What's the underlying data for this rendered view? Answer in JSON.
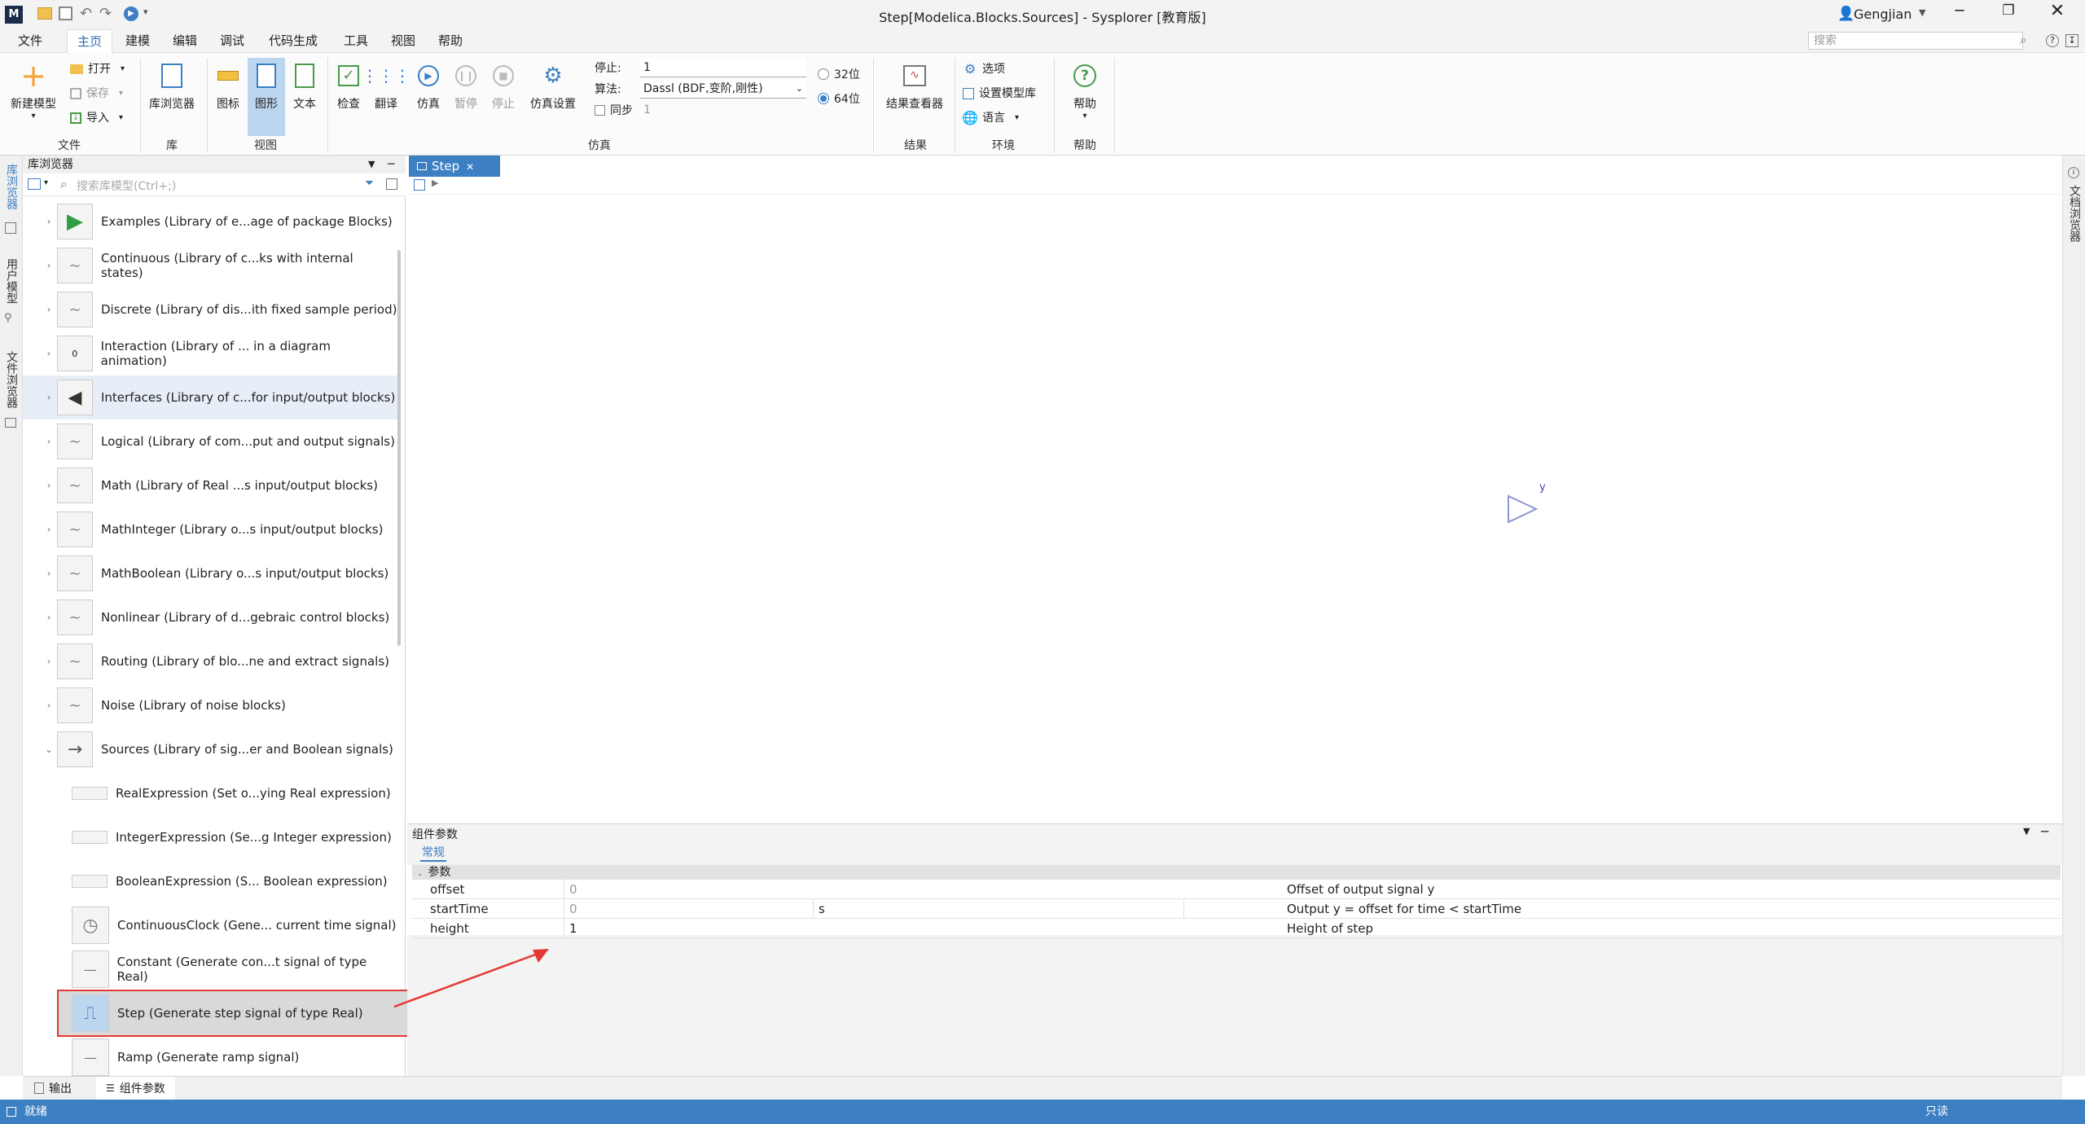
{
  "window": {
    "title": "Step[Modelica.Blocks.Sources] - Sysplorer [教育版]",
    "user": "Gengjian"
  },
  "menus": [
    "文件",
    "主页",
    "建模",
    "编辑",
    "调试",
    "代码生成",
    "工具",
    "视图",
    "帮助"
  ],
  "search_placeholder": "搜索",
  "ribbon": {
    "file_group": {
      "label": "文件",
      "new_model": "新建模型",
      "open": "打开",
      "save": "保存",
      "import": "导入"
    },
    "lib_group": {
      "label": "库",
      "lib_browser": "库浏览器"
    },
    "view_group": {
      "label": "视图",
      "icon": "图标",
      "diagram": "图形",
      "text": "文本"
    },
    "sim_group": {
      "label": "仿真",
      "check": "检查",
      "translate": "翻译",
      "simulate": "仿真",
      "pause": "暂停",
      "stop": "停止",
      "sim_settings": "仿真设置",
      "stop_label": "停止:",
      "stop_value": "1",
      "algo_label": "算法:",
      "algo_value": "Dassl (BDF,变阶,刚性)",
      "sync_label": "同步",
      "sync_value": "1",
      "bits32": "32位",
      "bits64": "64位"
    },
    "result_group": {
      "label": "结果",
      "viewer": "结果查看器"
    },
    "env_group": {
      "label": "环境",
      "options": "选项",
      "set_lib": "设置模型库",
      "language": "语言"
    },
    "help_group": {
      "label": "帮助",
      "help": "帮助"
    }
  },
  "left_tabs": [
    "库浏览器",
    "用户模型",
    "文件浏览器"
  ],
  "right_tabs": [
    "文档浏览器"
  ],
  "library": {
    "header": "库浏览器",
    "search_placeholder": "搜索库模型(Ctrl+;)",
    "items": [
      {
        "label": "Examples (Library of e...age of package Blocks)"
      },
      {
        "label": "Continuous (Library of c...ks with internal states)"
      },
      {
        "label": "Discrete (Library of dis...ith fixed sample period)"
      },
      {
        "label": "Interaction (Library of ... in a diagram animation)"
      },
      {
        "label": "Interfaces (Library of c...for input/output blocks)"
      },
      {
        "label": "Logical (Library of com...put and output signals)"
      },
      {
        "label": "Math (Library of Real ...s input/output blocks)"
      },
      {
        "label": "MathInteger (Library o...s input/output blocks)"
      },
      {
        "label": "MathBoolean (Library o...s input/output blocks)"
      },
      {
        "label": "Nonlinear (Library of d...gebraic control blocks)"
      },
      {
        "label": "Routing (Library of blo...ne and extract signals)"
      },
      {
        "label": "Noise (Library of noise blocks)"
      },
      {
        "label": "Sources (Library of sig...er and Boolean signals)"
      }
    ],
    "sub_items": [
      {
        "label": "RealExpression (Set o...ying Real expression)"
      },
      {
        "label": "IntegerExpression (Se...g Integer expression)"
      },
      {
        "label": "BooleanExpression (S... Boolean expression)"
      },
      {
        "label": "ContinuousClock (Gene... current time signal)"
      },
      {
        "label": "Constant (Generate con...t signal of type Real)"
      },
      {
        "label": "Step (Generate step signal of type Real)"
      },
      {
        "label": "Ramp (Generate ramp signal)"
      }
    ],
    "interaction_icon_text": "0"
  },
  "document": {
    "tab": "Step",
    "output_label": "y"
  },
  "params": {
    "title": "组件参数",
    "tab": "常规",
    "section": "参数",
    "rows": [
      {
        "name": "offset",
        "value": "0",
        "unit": "",
        "desc": "Offset of output signal y"
      },
      {
        "name": "startTime",
        "value": "0",
        "unit": "s",
        "desc": "Output y = offset for time < startTime"
      },
      {
        "name": "height",
        "value": "1",
        "unit": "",
        "desc": "Height of step"
      }
    ]
  },
  "bottom_tabs": [
    "输出",
    "组件参数"
  ],
  "status": {
    "left": "就绪",
    "right": "只读"
  },
  "colors": {
    "accent": "#3c7fc3",
    "highlight_red": "#e53935"
  }
}
